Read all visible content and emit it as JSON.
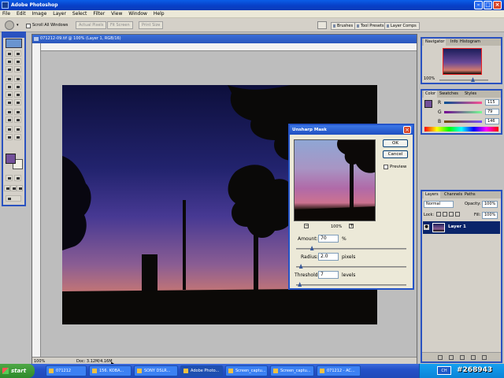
{
  "app": {
    "title": "Adobe Photoshop"
  },
  "menu": [
    "File",
    "Edit",
    "Image",
    "Layer",
    "Select",
    "Filter",
    "View",
    "Window",
    "Help"
  ],
  "options": {
    "scroll_all": "Scroll All Windows",
    "buttons": [
      "Actual Pixels",
      "Fit Screen",
      "Print Size"
    ],
    "well_tabs": [
      "Brushes",
      "Tool Presets",
      "Layer Comps"
    ]
  },
  "document": {
    "title": "071212-09.tif @ 100% (Layer 1, RGB/16)",
    "zoom": "100%",
    "doc_info": "Doc: 3.12M/4.16M"
  },
  "navigator": {
    "tabs": [
      "Navigator",
      "Info",
      "Histogram"
    ],
    "zoom": "100%"
  },
  "color_panel": {
    "tabs": [
      "Color",
      "Swatches",
      "Styles"
    ],
    "channels": [
      "R",
      "G",
      "B"
    ],
    "values": [
      "115",
      "79",
      "146"
    ]
  },
  "layers": {
    "tabs": [
      "Layers",
      "Channels",
      "Paths"
    ],
    "blend_mode": "Normal",
    "opacity_label": "Opacity:",
    "opacity": "100%",
    "lock_label": "Lock:",
    "fill_label": "Fill:",
    "fill": "100%",
    "layer_name": "Layer 1"
  },
  "dialog": {
    "title": "Unsharp Mask",
    "ok": "OK",
    "cancel": "Cancel",
    "preview": "Preview",
    "zoom": "100%",
    "amount_label": "Amount:",
    "amount": "70",
    "amount_unit": "%",
    "radius_label": "Radius:",
    "radius": "2.0",
    "radius_unit": "pixels",
    "threshold_label": "Threshold:",
    "threshold": "7",
    "threshold_unit": "levels",
    "amount_level": 0.14,
    "radius_level": 0.04,
    "threshold_level": 0.03
  },
  "taskbar": {
    "start": "start",
    "items": [
      "071212",
      "156. KOBA...",
      "SONY DSLR...",
      "Adobe Photo...",
      "Screen_captu...",
      "Screen_captu...",
      "071212 - AC..."
    ],
    "tray_lang": "CH"
  },
  "watermark": "#268943"
}
